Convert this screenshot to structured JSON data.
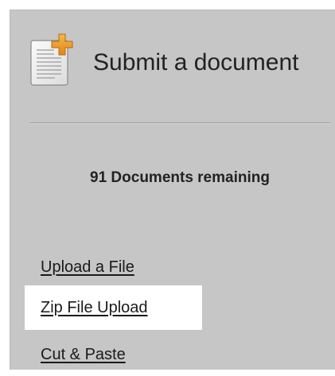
{
  "header": {
    "title": "Submit a document",
    "icon": "document-add-icon"
  },
  "status": {
    "remaining_text": "91 Documents remaining"
  },
  "links": [
    {
      "label": "Upload a File",
      "highlighted": false
    },
    {
      "label": "Zip File Upload",
      "highlighted": true
    },
    {
      "label": "Cut & Paste",
      "highlighted": false
    }
  ],
  "colors": {
    "panel_background": "#c6c6c6",
    "highlight_background": "#ffffff",
    "icon_plus": "#e89a1e"
  }
}
